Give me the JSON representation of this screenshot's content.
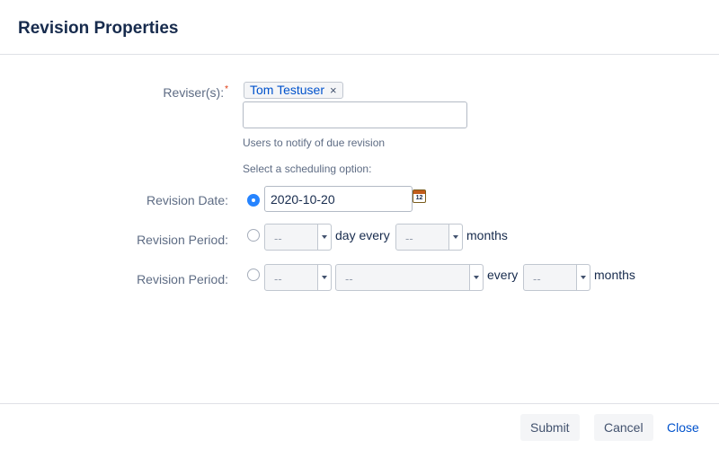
{
  "dialog": {
    "title": "Revision Properties"
  },
  "revisers": {
    "label": "Reviser(s):",
    "required_marker": "*",
    "chips": [
      {
        "name": "Tom Testuser",
        "remove": "×"
      }
    ],
    "input_value": "",
    "help": "Users to notify of due revision"
  },
  "schedule": {
    "prompt": "Select a scheduling option:",
    "revision_date": {
      "label": "Revision Date:",
      "selected": true,
      "value": "2020-10-20",
      "calendar_text": "12"
    },
    "period1": {
      "label": "Revision Period:",
      "selected": false,
      "day_value": "--",
      "day_every_text": "day every",
      "months_value": "--",
      "months_text": "months"
    },
    "period2": {
      "label": "Revision Period:",
      "selected": false,
      "first_value": "--",
      "second_value": "--",
      "every_text": "every",
      "months_value": "--",
      "months_text": "months"
    }
  },
  "footer": {
    "submit": "Submit",
    "cancel": "Cancel",
    "close": "Close"
  }
}
